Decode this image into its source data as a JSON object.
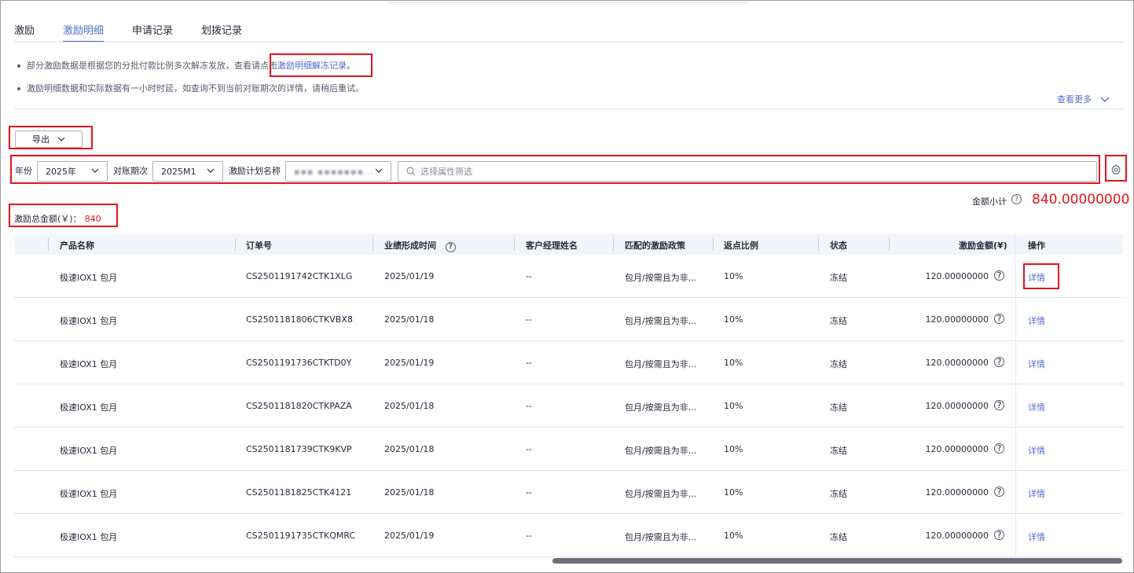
{
  "tabs": [
    {
      "label": "激励"
    },
    {
      "label": "激励明细"
    },
    {
      "label": "申请记录"
    },
    {
      "label": "划拨记录"
    }
  ],
  "notice": {
    "line1_prefix": "部分激励数据是根据您的分批付款比例多次解冻发放，查看请点击",
    "line1_link": "激励明细解冻记录",
    "line1_suffix": "。",
    "line2": "激励明细数据和实际数据有一小时时延，如查询不到当前对账期次的详情，请稍后重试。",
    "see_more": "查看更多"
  },
  "toolbar": {
    "export_label": "导出"
  },
  "filters": {
    "year_label": "年份",
    "year_value": "2025年",
    "period_label": "对账期次",
    "period_value": "2025M1",
    "plan_label": "激励计划名称",
    "plan_value": "▪▪▪ ▪▪▪▪▪▪▪...",
    "search_placeholder": "选择属性筛选"
  },
  "summary": {
    "subtotal_label": "金额小计",
    "subtotal_value": "840.00000000",
    "total_label": "激励总金额(￥)：",
    "total_value": "840"
  },
  "table": {
    "headers": [
      "产品名称",
      "订单号",
      "业绩形成时间",
      "客户经理姓名",
      "匹配的激励政策",
      "返点比例",
      "状态",
      "激励金额(¥)",
      "操作"
    ],
    "rows": [
      {
        "product": "极速IOX1 包月",
        "order": "CS2501191742CTK1XLG",
        "date": "2025/01/19",
        "manager": "--",
        "policy": "包月/按需且为非...",
        "rate": "10%",
        "status": "冻结",
        "amount": "120.00000000",
        "action": "详情"
      },
      {
        "product": "极速IOX1 包月",
        "order": "CS2501181806CTKVBX8",
        "date": "2025/01/18",
        "manager": "--",
        "policy": "包月/按需且为非...",
        "rate": "10%",
        "status": "冻结",
        "amount": "120.00000000",
        "action": "详情"
      },
      {
        "product": "极速IOX1 包月",
        "order": "CS2501191736CTKTD0Y",
        "date": "2025/01/19",
        "manager": "--",
        "policy": "包月/按需且为非...",
        "rate": "10%",
        "status": "冻结",
        "amount": "120.00000000",
        "action": "详情"
      },
      {
        "product": "极速IOX1 包月",
        "order": "CS2501181820CTKPAZA",
        "date": "2025/01/18",
        "manager": "--",
        "policy": "包月/按需且为非...",
        "rate": "10%",
        "status": "冻结",
        "amount": "120.00000000",
        "action": "详情"
      },
      {
        "product": "极速IOX1 包月",
        "order": "CS2501181739CTK9KVP",
        "date": "2025/01/18",
        "manager": "--",
        "policy": "包月/按需且为非...",
        "rate": "10%",
        "status": "冻结",
        "amount": "120.00000000",
        "action": "详情"
      },
      {
        "product": "极速IOX1 包月",
        "order": "CS2501181825CTK4121",
        "date": "2025/01/18",
        "manager": "--",
        "policy": "包月/按需且为非...",
        "rate": "10%",
        "status": "冻结",
        "amount": "120.00000000",
        "action": "详情"
      },
      {
        "product": "极速IOX1 包月",
        "order": "CS2501191735CTKQMRC",
        "date": "2025/01/19",
        "manager": "--",
        "policy": "包月/按需且为非...",
        "rate": "10%",
        "status": "冻结",
        "amount": "120.00000000",
        "action": "详情"
      }
    ]
  },
  "colors": {
    "accent": "#526ecc",
    "highlight": "#e5141b"
  }
}
